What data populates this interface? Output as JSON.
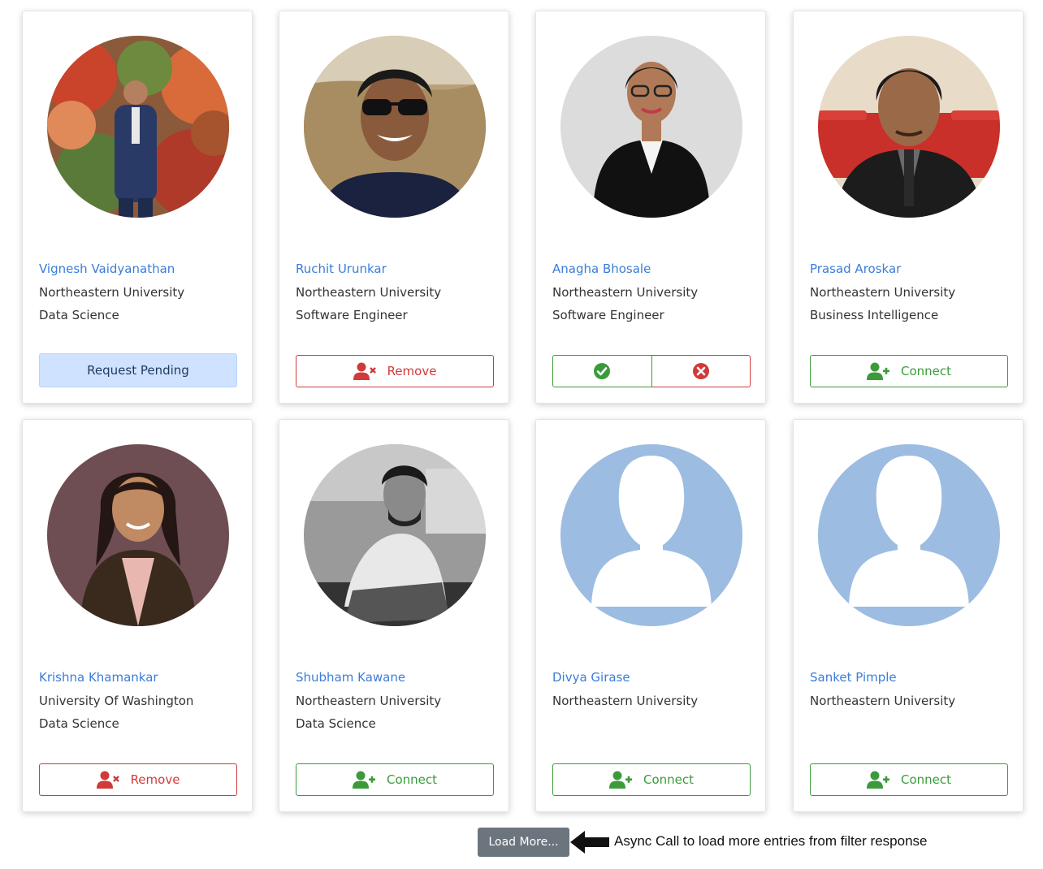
{
  "profiles": [
    {
      "name": "Vignesh Vaidyanathan",
      "school": "Northeastern University",
      "field": "Data Science",
      "action": "Request Pending"
    },
    {
      "name": "Ruchit Urunkar",
      "school": "Northeastern University",
      "field": "Software Engineer",
      "action": "Remove"
    },
    {
      "name": "Anagha Bhosale",
      "school": "Northeastern University",
      "field": "Software Engineer",
      "action": ""
    },
    {
      "name": "Prasad Aroskar",
      "school": "Northeastern University",
      "field": "Business Intelligence",
      "action": "Connect"
    },
    {
      "name": "Krishna Khamankar",
      "school": "University Of Washington",
      "field": "Data Science",
      "action": "Remove"
    },
    {
      "name": "Shubham Kawane",
      "school": "Northeastern University",
      "field": "Data Science",
      "action": "Connect"
    },
    {
      "name": "Divya Girase",
      "school": "Northeastern University",
      "field": "",
      "action": "Connect"
    },
    {
      "name": "Sanket Pimple",
      "school": "Northeastern University",
      "field": "",
      "action": "Connect"
    }
  ],
  "load_more_label": "Load More...",
  "annotation": "Async Call to load more entries from filter response",
  "colors": {
    "name_link": "#3b7dd8",
    "connect": "#3b9b3b",
    "remove": "#d03a3a",
    "pending_bg": "#cfe2ff",
    "load_more_bg": "#6c757d",
    "placeholder_avatar": "#9cbce2"
  },
  "icons": {
    "connect": "user-plus-icon",
    "remove": "user-times-icon",
    "accept": "check-circle-icon",
    "reject": "times-circle-icon",
    "arrow": "left-arrow-icon"
  }
}
